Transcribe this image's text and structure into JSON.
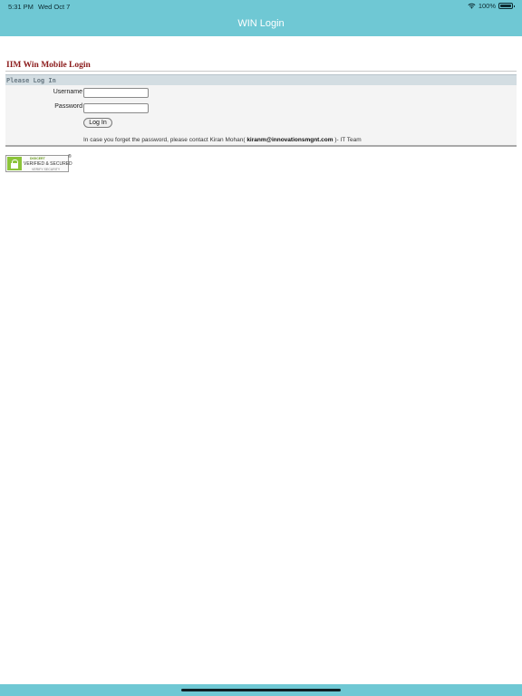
{
  "status_bar": {
    "time": "5:31 PM",
    "date": "Wed Oct 7",
    "battery": "100%"
  },
  "nav": {
    "title": "WIN Login"
  },
  "page": {
    "heading": "IIM Win Mobile Login",
    "panel_title": "Please Log In"
  },
  "form": {
    "username_label": "Username",
    "password_label": "Password",
    "username_value": "",
    "password_value": "",
    "login_button": "Log In"
  },
  "help": {
    "prefix": "In case you forget the password, please contact Kiran Mohan(",
    "email": "kiranm@innovationsmgnt.com",
    "suffix": ")- IT Team"
  },
  "seal": {
    "brand": "DIGICERT",
    "text": "VERIFIED & SECURED",
    "sub": "VERIFY SECURITY",
    "reg": "®"
  },
  "colors": {
    "bar": "#6fc8d4",
    "heading": "#8b1a1a",
    "panel_header": "#d3dde2"
  }
}
